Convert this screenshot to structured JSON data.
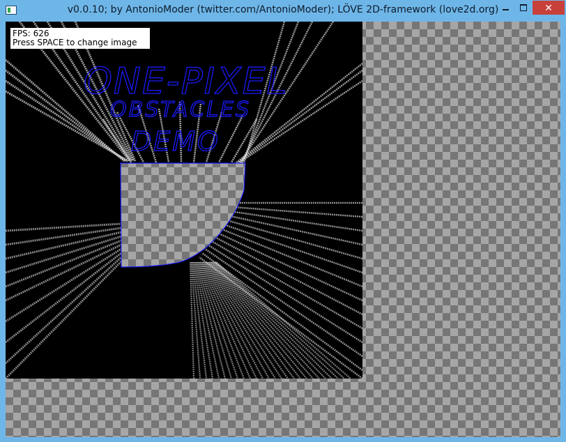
{
  "window": {
    "title": "v0.0.10; by AntonioModer (twitter.com/AntonioModer); LÖVE 2D-framework (love2d.org)",
    "controls": {
      "minimize_icon": "minimize-icon",
      "maximize_icon": "maximize-icon",
      "close_icon": "close-icon",
      "close_glyph": "✕"
    }
  },
  "hud": {
    "fps_line": "FPS: 626",
    "hint_line": "Press SPACE to change image"
  },
  "scene": {
    "drawing_line1": "ONE-PIXEL",
    "drawing_line2": "OBSTACLES",
    "drawing_line3": "DEMO",
    "drawing_color": "#1a1aff",
    "obstacle_outline_color": "#2020ff"
  }
}
